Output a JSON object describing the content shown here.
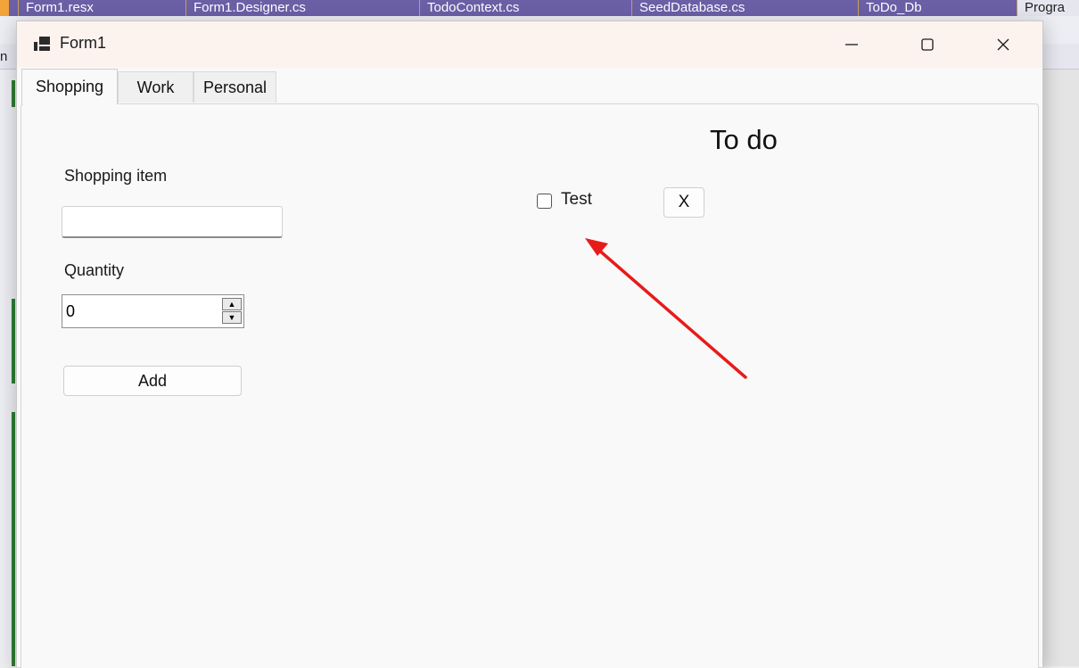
{
  "ide": {
    "tabs": [
      {
        "label": "Form1.resx"
      },
      {
        "label": "Form1.Designer.cs"
      },
      {
        "label": "TodoContext.cs"
      },
      {
        "label": "SeedDatabase.cs"
      },
      {
        "label": "ToDo_Db"
      },
      {
        "label": "Progra"
      }
    ],
    "left_char": "n"
  },
  "window": {
    "title": "Form1",
    "min_label": "—",
    "max_label": "☐",
    "close_label": "✕"
  },
  "tabs": [
    {
      "label": "Shopping",
      "active": true
    },
    {
      "label": "Work",
      "active": false
    },
    {
      "label": "Personal",
      "active": false
    }
  ],
  "form": {
    "item_label": "Shopping item",
    "item_value": "",
    "quantity_label": "Quantity",
    "quantity_value": "0",
    "spin_up": "▲",
    "spin_down": "▼",
    "add_label": "Add"
  },
  "todo": {
    "title": "To do",
    "items": [
      {
        "label": "Test",
        "checked": false,
        "delete_label": "X"
      }
    ]
  },
  "colors": {
    "arrow": "#e81b1b",
    "ide_accent": "#6b5fa6",
    "gutter": "#2e7d32"
  }
}
